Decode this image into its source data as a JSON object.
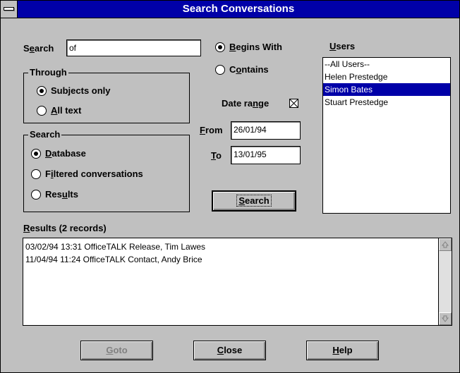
{
  "window": {
    "title": "Search Conversations"
  },
  "search": {
    "label_pre": "S",
    "label_ul": "e",
    "label_post": "arch",
    "value": "of"
  },
  "match": {
    "begins_with": {
      "ul": "B",
      "rest": "egins With",
      "selected": true
    },
    "contains": {
      "pre": "C",
      "ul": "o",
      "rest": "ntains",
      "selected": false
    }
  },
  "through": {
    "legend": "Through",
    "subjects_only": {
      "label": "Subjects only",
      "selected": true
    },
    "all_text": {
      "ul": "A",
      "rest": "ll text",
      "selected": false
    }
  },
  "search_scope": {
    "legend": "Search",
    "database": {
      "ul": "D",
      "rest": "atabase",
      "selected": true
    },
    "filtered": {
      "pre": "F",
      "ul": "i",
      "rest": "ltered conversations",
      "selected": false
    },
    "results": {
      "pre": "Res",
      "ul": "u",
      "rest": "lts",
      "selected": false
    }
  },
  "date_range": {
    "label_pre": "Date ra",
    "label_ul": "n",
    "label_post": "ge",
    "checked": true
  },
  "from": {
    "ul": "F",
    "rest": "rom",
    "value": "26/01/94"
  },
  "to": {
    "ul": "T",
    "rest": "o",
    "value": "13/01/95"
  },
  "users": {
    "ul": "U",
    "rest": "sers",
    "items": [
      "--All Users--",
      "Helen Prestedge",
      "Simon Bates",
      "Stuart Prestedge"
    ],
    "selected": "Simon Bates"
  },
  "search_button": {
    "ul": "S",
    "rest": "earch"
  },
  "results": {
    "ul": "R",
    "rest": "esults (2 records)",
    "items": [
      "03/02/94 13:31 OfficeTALK Release, Tim Lawes",
      "11/04/94 11:24 OfficeTALK Contact, Andy Brice"
    ]
  },
  "buttons": {
    "goto": {
      "ul": "G",
      "rest": "oto",
      "enabled": false
    },
    "close": {
      "ul": "C",
      "rest": "lose"
    },
    "help": {
      "ul": "H",
      "rest": "elp"
    }
  },
  "icons": {
    "system_menu": "system-menu-icon",
    "scroll_up": "scroll-up-arrow-icon",
    "scroll_down": "scroll-down-arrow-icon",
    "check": "check-x-icon"
  },
  "colors": {
    "titlebar": "#0000a8",
    "face": "#c0c0c0",
    "selection": "#0000a8"
  }
}
